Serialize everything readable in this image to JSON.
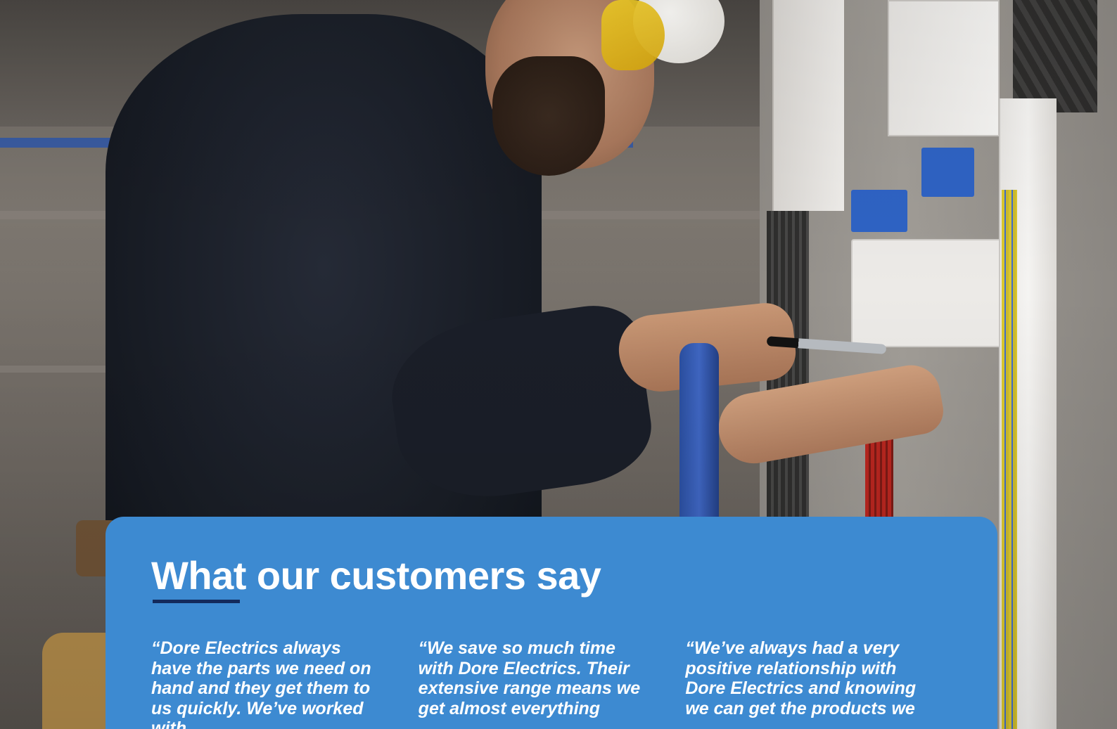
{
  "photo": {
    "subject": "electrician-at-fuse-board"
  },
  "testimonials": {
    "heading": "What our customers say",
    "quotes": [
      "“Dore Electrics always have the parts we need on hand and they get them to us quickly. We’ve worked with",
      "“We save so much time with Dore Electrics. Their extensive range means we get almost everything",
      "“We’ve always had a very positive relationship with Dore Electrics and knowing we can get the products we"
    ]
  },
  "colors": {
    "card_background": "#3d8ad1",
    "underline": "#132a5c",
    "text": "#ffffff"
  }
}
